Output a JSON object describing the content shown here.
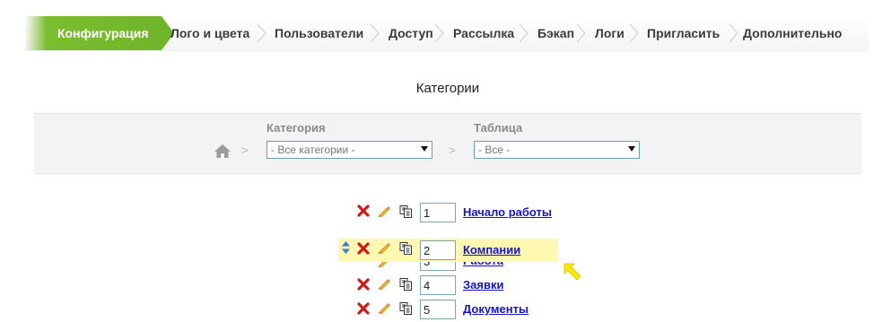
{
  "tabs": [
    {
      "label": "Конфигурация",
      "active": true
    },
    {
      "label": "Лого и цвета"
    },
    {
      "label": "Пользователи"
    },
    {
      "label": "Доступ"
    },
    {
      "label": "Рассылка"
    },
    {
      "label": "Бэкап"
    },
    {
      "label": "Логи"
    },
    {
      "label": "Пригласить"
    },
    {
      "label": "Дополнительно"
    }
  ],
  "page": {
    "title": "Категории"
  },
  "filters": {
    "separator": ">",
    "category": {
      "label": "Категория",
      "selected": "- Все категории -"
    },
    "table": {
      "label": "Таблица",
      "selected": "- Все -"
    }
  },
  "categories": [
    {
      "order": "1",
      "name": "Начало работы"
    },
    {
      "order": "2",
      "name": "Компании",
      "dragging": true
    },
    {
      "order": "3",
      "name": "Работа"
    },
    {
      "order": "4",
      "name": "Заявки"
    },
    {
      "order": "5",
      "name": "Документы"
    }
  ],
  "colors": {
    "accent": "#7abd2f",
    "link": "#1414c8",
    "drag_highlight": "#fff8b0",
    "cursor": "#ffe800"
  },
  "icons": [
    "home-icon",
    "delete-icon",
    "edit-icon",
    "copy-icon",
    "sort-arrows-icon",
    "cursor-arrow-icon"
  ]
}
